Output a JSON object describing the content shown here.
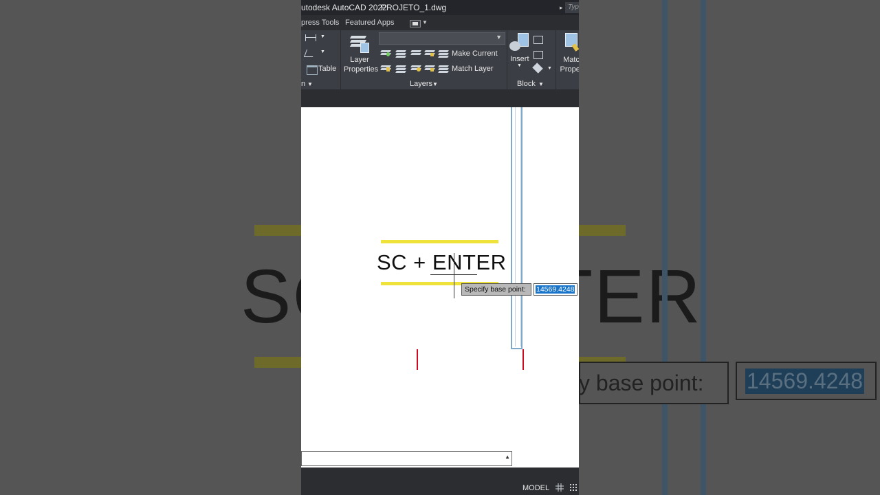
{
  "window": {
    "app_title": "utodesk AutoCAD 2022",
    "file_name": "PROJETO_1.dwg",
    "search_hint": "Typ"
  },
  "ribbon_tabs": {
    "tab_express": "press Tools",
    "tab_featured": "Featured Apps"
  },
  "ribbon": {
    "table_label": "Table",
    "layer_properties_label": "Layer\nProperties",
    "make_current_label": "Make Current",
    "match_layer_label": "Match Layer",
    "layers_panel_title": "Layers",
    "insert_label": "Insert",
    "block_panel_title": "Block",
    "match_properties_label": "Matc\nProper",
    "annotation_panel_title_fragment": "n"
  },
  "overlay": {
    "caption": "SC + ENTER",
    "accent_color": "#efe23b"
  },
  "dynamic_input": {
    "prompt": "Specify base point:",
    "value": "14569.4248",
    "bg_prompt_fragment": "y base point:"
  },
  "statusbar": {
    "model_label": "MODEL"
  },
  "colors": {
    "frame_dark": "#2b2d31",
    "ribbon": "#3b3e44",
    "selection_blue": "#1975c9",
    "red_marker": "#cc0b1e",
    "geometry_blue": "#7fa8c9"
  }
}
